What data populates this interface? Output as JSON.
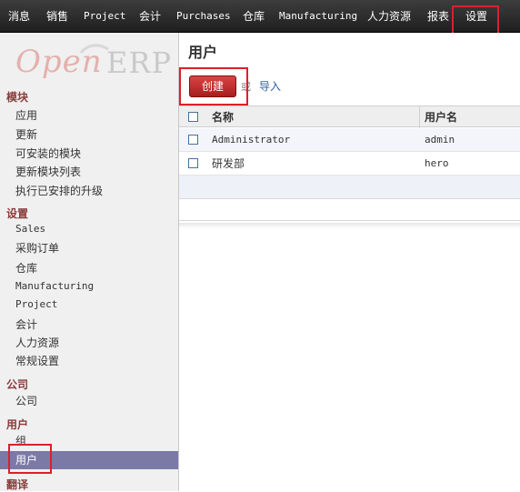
{
  "topbar": {
    "menus": [
      "消息",
      "销售",
      "Project",
      "会计",
      "Purchases",
      "仓库",
      "Manufacturing",
      "人力资源",
      "报表",
      "设置"
    ]
  },
  "sidebar": {
    "logo": {
      "open": "Open",
      "erp": "ERP"
    },
    "sections": [
      {
        "title": "模块",
        "items": [
          "应用",
          "更新",
          "可安装的模块",
          "更新模块列表",
          "执行已安排的升级"
        ]
      },
      {
        "title": "设置",
        "items": [
          "Sales",
          "采购订单",
          "仓库",
          "Manufacturing",
          "Project",
          "会计",
          "人力资源",
          "常规设置"
        ]
      },
      {
        "title": "公司",
        "items": [
          "公司"
        ]
      },
      {
        "title": "用户",
        "items": [
          "组",
          "用户"
        ]
      },
      {
        "title": "翻译",
        "items": []
      }
    ],
    "active_item": "用户"
  },
  "main": {
    "title": "用户",
    "create_label": "创建",
    "or_text": "或",
    "import_label": "导入",
    "columns": [
      "名称",
      "用户名"
    ],
    "rows": [
      {
        "name": "Administrator",
        "login": "admin"
      },
      {
        "name": "研发部",
        "login": "hero"
      }
    ]
  },
  "colors": {
    "topbar": "#2b2b2b",
    "highlight": "#d9212a",
    "active_menu": "#7b7aa6",
    "create_button": "#c03030",
    "section_title": "#8a3b3b"
  }
}
